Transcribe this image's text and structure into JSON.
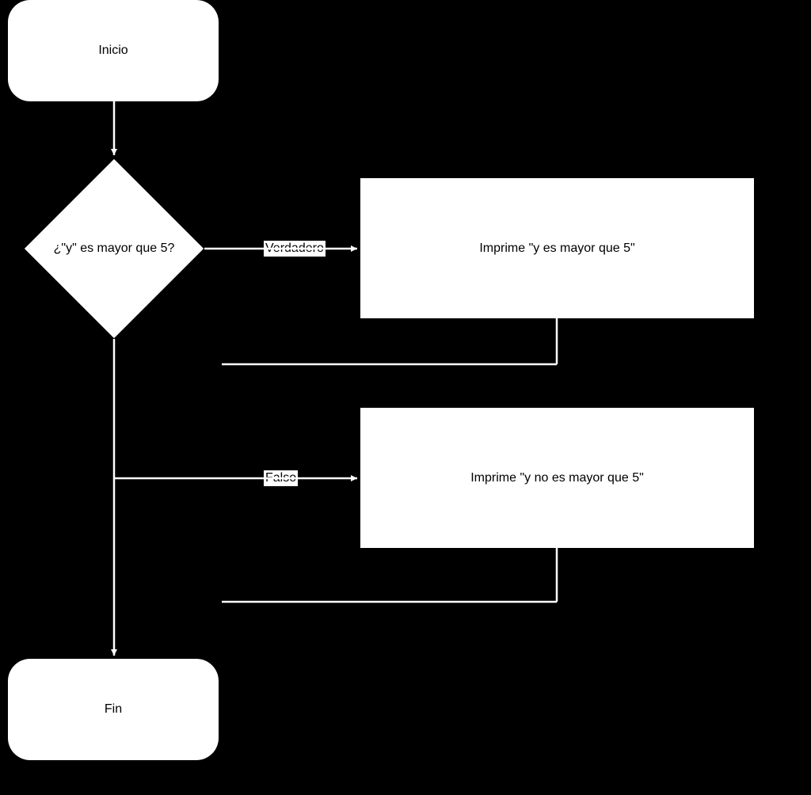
{
  "nodes": {
    "start": {
      "label": "Inicio"
    },
    "decision": {
      "label": "¿\"y\" es mayor que 5?"
    },
    "print_true": {
      "label": "Imprime \"y es mayor que 5\""
    },
    "print_false": {
      "label": "Imprime \"y no es mayor que 5\""
    },
    "end": {
      "label": "Fin"
    }
  },
  "edges": {
    "true_label": "Verdadero",
    "false_label": "Falso"
  }
}
